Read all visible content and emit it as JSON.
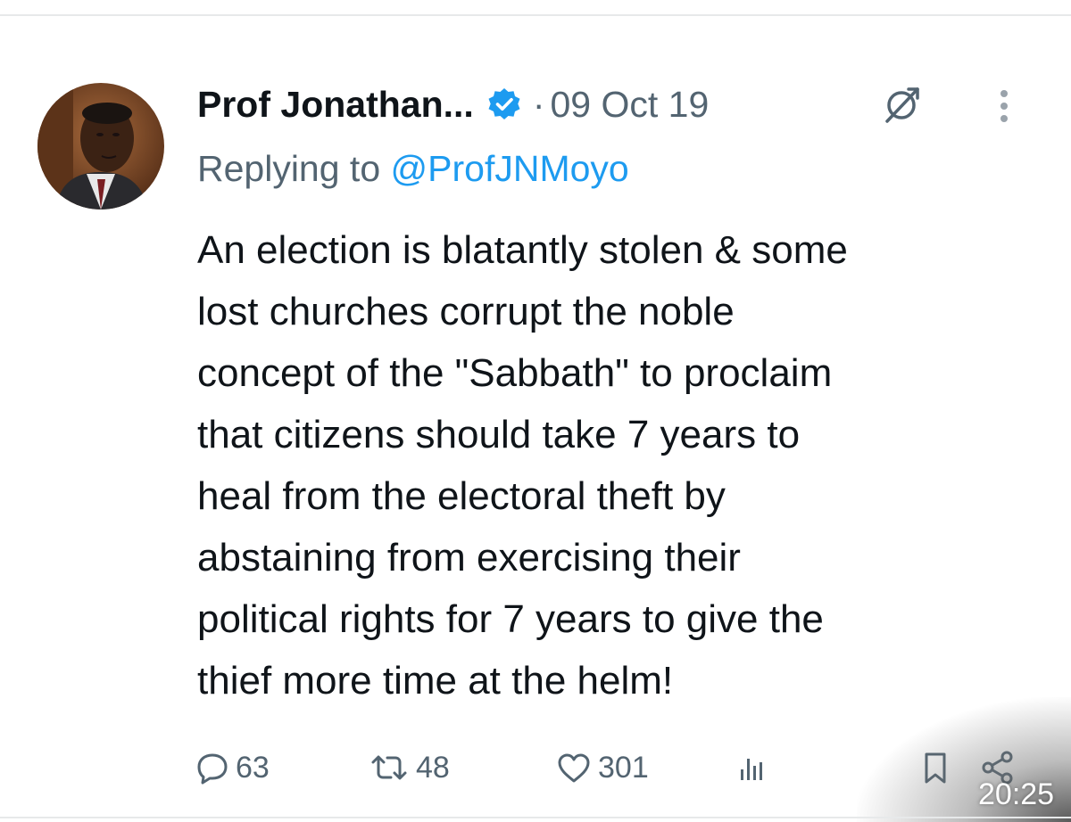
{
  "post": {
    "author_name": "Prof Jonathan...",
    "separator": "·",
    "date": "09 Oct 19",
    "replying_prefix": "Replying to ",
    "replying_handle": "@ProfJNMoyo",
    "text_lines": [
      "An election is blatantly stolen & some",
      "lost churches corrupt the noble",
      "concept of the \"Sabbath\" to proclaim",
      "that citizens should take 7 years to",
      "heal from the electoral theft by",
      "abstaining from exercising their",
      "political rights for 7 years to give the",
      "thief more time at the helm!"
    ]
  },
  "actions": {
    "replies": "63",
    "reposts": "48",
    "likes": "301"
  },
  "icons": {
    "verified": "verified-badge-icon",
    "grok": "grok-icon",
    "more": "more-vertical-icon",
    "reply": "reply-icon",
    "repost": "repost-icon",
    "like": "heart-icon",
    "views": "analytics-icon",
    "bookmark": "bookmark-icon",
    "share": "share-icon"
  },
  "status_bar": {
    "time": "20:25"
  },
  "colors": {
    "accent": "#1d9bf0",
    "secondary_text": "#536471",
    "primary_text": "#0f1419"
  }
}
